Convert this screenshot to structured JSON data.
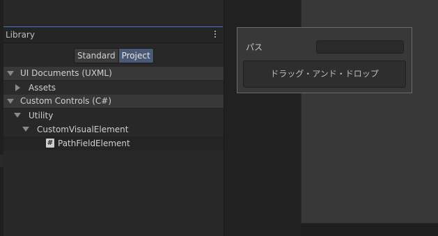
{
  "library": {
    "title": "Library",
    "toggle": {
      "standard": "Standard",
      "project": "Project"
    },
    "tree": [
      {
        "label": "UI Documents (UXML)",
        "expanded": true
      },
      {
        "label": "Assets",
        "expanded": false
      },
      {
        "label": "Custom Controls (C#)",
        "expanded": true
      },
      {
        "label": "Utility",
        "expanded": true
      },
      {
        "label": "CustomVisualElement",
        "expanded": true
      },
      {
        "label": "PathFieldElement",
        "icon": "csharp-hash-icon"
      }
    ]
  },
  "element": {
    "path_label": "パス",
    "path_value": "",
    "drop_button": "ドラッグ・アンド・ドロップ"
  },
  "colors": {
    "accent": "#3d7bd6",
    "project_toggle": "#4a5a76"
  }
}
